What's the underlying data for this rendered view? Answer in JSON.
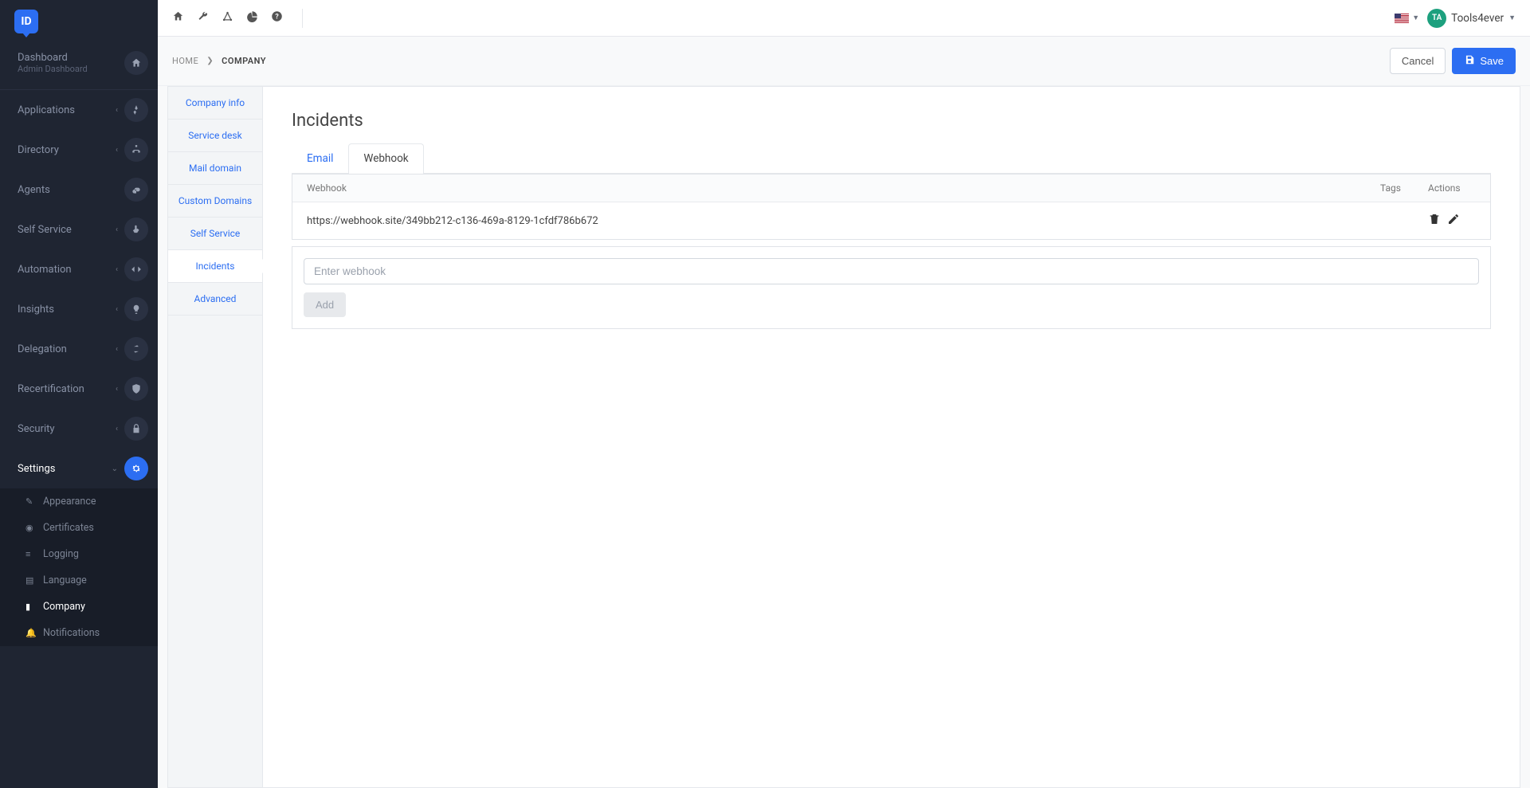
{
  "logo_text": "ID",
  "sidebar": {
    "dashboard": {
      "label": "Dashboard",
      "subtitle": "Admin Dashboard"
    },
    "items": [
      {
        "label": "Applications"
      },
      {
        "label": "Directory"
      },
      {
        "label": "Agents"
      },
      {
        "label": "Self Service"
      },
      {
        "label": "Automation"
      },
      {
        "label": "Insights"
      },
      {
        "label": "Delegation"
      },
      {
        "label": "Recertification"
      },
      {
        "label": "Security"
      },
      {
        "label": "Settings"
      }
    ],
    "settings_sub": [
      {
        "label": "Appearance"
      },
      {
        "label": "Certificates"
      },
      {
        "label": "Logging"
      },
      {
        "label": "Language"
      },
      {
        "label": "Company"
      },
      {
        "label": "Notifications"
      }
    ]
  },
  "topbar": {
    "avatar_initials": "TA",
    "username": "Tools4ever"
  },
  "breadcrumb": {
    "home": "HOME",
    "current": "COMPANY",
    "cancel": "Cancel",
    "save": "Save"
  },
  "inner_nav": [
    "Company info",
    "Service desk",
    "Mail domain",
    "Custom Domains",
    "Self Service",
    "Incidents",
    "Advanced"
  ],
  "page": {
    "title": "Incidents",
    "tabs": {
      "email": "Email",
      "webhook": "Webhook"
    },
    "table": {
      "col_webhook": "Webhook",
      "col_tags": "Tags",
      "col_actions": "Actions",
      "rows": [
        {
          "url": "https://webhook.site/349bb212-c136-469a-8129-1cfdf786b672"
        }
      ]
    },
    "add": {
      "placeholder": "Enter webhook",
      "button": "Add"
    }
  }
}
